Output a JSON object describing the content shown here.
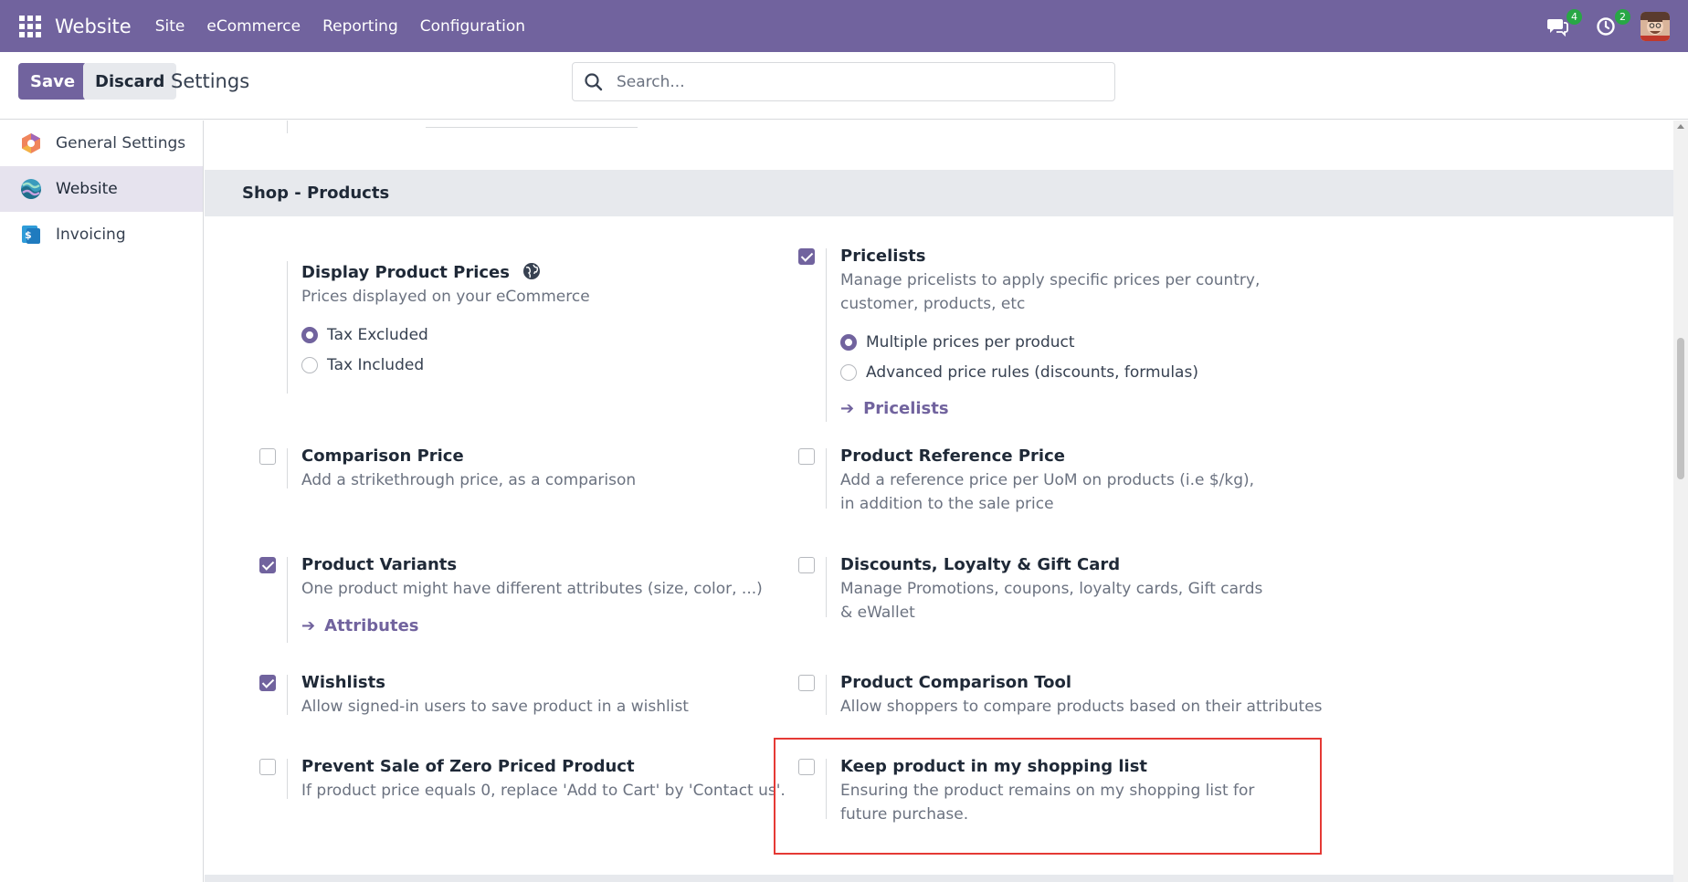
{
  "navbar": {
    "brand": "Website",
    "menu": [
      "Site",
      "eCommerce",
      "Reporting",
      "Configuration"
    ],
    "messages_count": "4",
    "activities_count": "2"
  },
  "control_panel": {
    "save_label": "Save",
    "discard_label": "Discard",
    "title": "Settings",
    "search_placeholder": "Search..."
  },
  "sidebar": {
    "items": [
      {
        "label": "General Settings",
        "icon": "odoo-logo-icon",
        "active": false
      },
      {
        "label": "Website",
        "icon": "website-app-icon",
        "active": true
      },
      {
        "label": "Invoicing",
        "icon": "invoicing-app-icon",
        "active": false
      }
    ]
  },
  "section": {
    "title": "Shop - Products"
  },
  "settings": {
    "display_prices": {
      "title": "Display Product Prices",
      "desc": "Prices displayed on your eCommerce",
      "options": [
        "Tax Excluded",
        "Tax Included"
      ],
      "selected": "Tax Excluded"
    },
    "pricelists": {
      "title": "Pricelists",
      "desc": "Manage pricelists to apply specific prices per country, customer, products, etc",
      "checked": true,
      "options": [
        "Multiple prices per product",
        "Advanced price rules (discounts, formulas)"
      ],
      "selected": "Multiple prices per product",
      "link": "Pricelists"
    },
    "comparison_price": {
      "title": "Comparison Price",
      "desc": "Add a strikethrough price, as a comparison",
      "checked": false
    },
    "reference_price": {
      "title": "Product Reference Price",
      "desc": "Add a reference price per UoM on products (i.e $/kg), in addition to the sale price",
      "checked": false
    },
    "variants": {
      "title": "Product Variants",
      "desc": "One product might have different attributes (size, color, ...)",
      "checked": true,
      "link": "Attributes"
    },
    "discounts": {
      "title": "Discounts, Loyalty & Gift Card",
      "desc": "Manage Promotions, coupons, loyalty cards, Gift cards & eWallet",
      "checked": false
    },
    "wishlists": {
      "title": "Wishlists",
      "desc": "Allow signed-in users to save product in a wishlist",
      "checked": true
    },
    "comparison_tool": {
      "title": "Product Comparison Tool",
      "desc": "Allow shoppers to compare products based on their attributes",
      "checked": false
    },
    "zero_price": {
      "title": "Prevent Sale of Zero Priced Product",
      "desc": "If product price equals 0, replace 'Add to Cart' by 'Contact us'.",
      "checked": false
    },
    "keep_product": {
      "title": "Keep product in my shopping list",
      "desc": "Ensuring the product remains on my shopping list for future purchase.",
      "checked": false
    }
  },
  "colors": {
    "primary": "#71639e",
    "highlight": "#e53935",
    "badge": "#28a745"
  }
}
